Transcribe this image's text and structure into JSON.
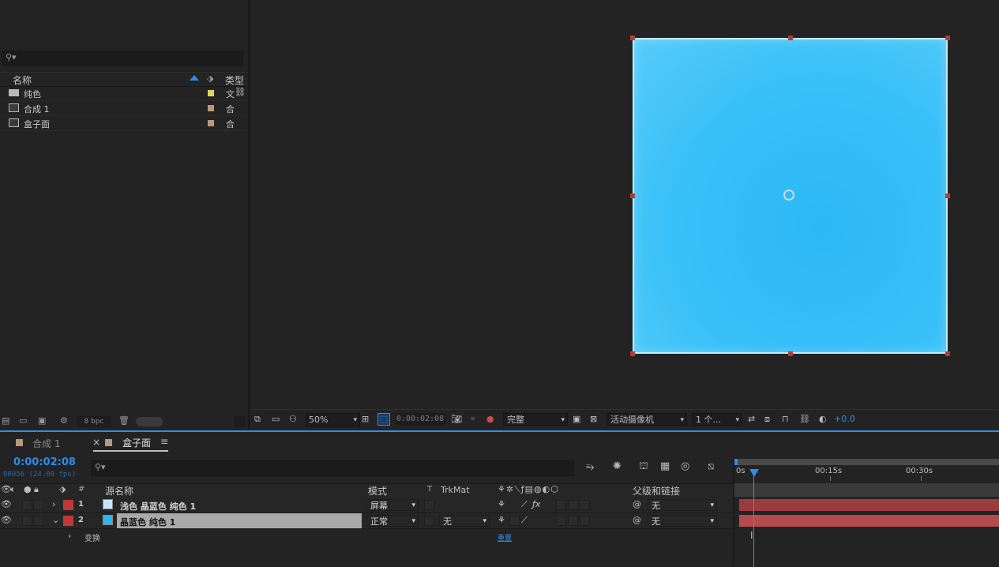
{
  "project": {
    "columns": {
      "name": "名称",
      "type": "类型"
    },
    "items": [
      {
        "name": "纯色",
        "type": "文",
        "color": "#e6d35c",
        "kind": "folder"
      },
      {
        "name": "合成 1",
        "type": "合",
        "color": "#b39b7a",
        "kind": "comp"
      },
      {
        "name": "盒子面",
        "type": "合",
        "color": "#b39b7a",
        "kind": "comp"
      }
    ],
    "footer": {
      "bpc": "8 bpc"
    }
  },
  "viewer": {
    "zoom": "50%",
    "timecode": "0:00:02:08",
    "resolution": "完整",
    "camera": "活动摄像机",
    "views": "1 个...",
    "exposure": "+0.0"
  },
  "timeline": {
    "tabs": [
      {
        "label": "合成 1",
        "active": false
      },
      {
        "label": "盒子面",
        "active": true
      }
    ],
    "current_time": "0:00:02:08",
    "frame_info": "00056 (24.00 fps)",
    "columns": {
      "num": "#",
      "source": "源名称",
      "mode": "模式",
      "t": "T",
      "trkmat": "TrkMat",
      "parent": "父级和链接"
    },
    "layers": [
      {
        "num": "1",
        "name": "浅色 晶蓝色 纯色 1",
        "mode": "屏幕",
        "trkmat": "",
        "parent": "无",
        "color": "#c6e6ff"
      },
      {
        "num": "2",
        "name": "晶蓝色 纯色 1",
        "mode": "正常",
        "trkmat": "无",
        "parent": "无",
        "color": "#2bb8f6"
      }
    ],
    "transform_label": "变换",
    "reset_label": "重置",
    "ruler": {
      "marks": [
        "0s",
        "00:15s",
        "00:30s"
      ]
    }
  }
}
